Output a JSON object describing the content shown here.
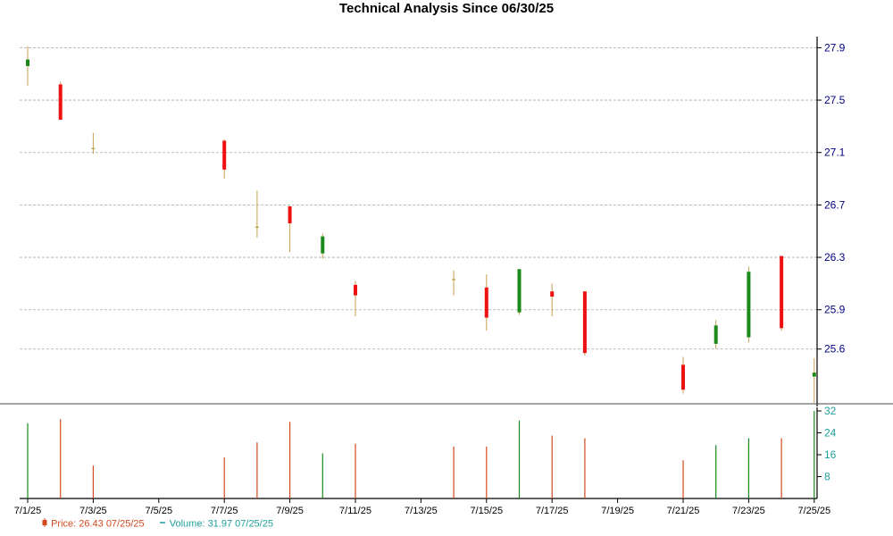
{
  "chart_data": {
    "type": "candlestick",
    "title": "Technical Analysis Since 06/30/25",
    "price_axis": {
      "ylim": [
        25.23,
        27.93
      ],
      "ticks": [
        "27.9",
        "27.5",
        "27.1",
        "26.7",
        "26.3",
        "25.9",
        "25.6"
      ]
    },
    "volume_axis": {
      "ylim": [
        0,
        32
      ],
      "ticks": [
        "32",
        "24",
        "16",
        "8"
      ]
    },
    "x_tick_labels": [
      "7/1/25",
      "7/3/25",
      "7/5/25",
      "7/7/25",
      "7/9/25",
      "7/11/25",
      "7/13/25",
      "7/15/25",
      "7/17/25",
      "7/19/25",
      "7/21/25",
      "7/23/25",
      "7/25/25"
    ],
    "candles": [
      {
        "date": "7/1/25",
        "open": 27.76,
        "high": 27.91,
        "low": 27.61,
        "close": 27.81,
        "volume": 27.5
      },
      {
        "date": "7/2/25",
        "open": 27.62,
        "high": 27.64,
        "low": 27.35,
        "close": 27.35,
        "volume": 29
      },
      {
        "date": "7/3/25",
        "open": 27.14,
        "high": 27.25,
        "low": 27.09,
        "close": 27.13,
        "volume": 12
      },
      {
        "date": "7/7/25",
        "open": 27.19,
        "high": 27.2,
        "low": 26.9,
        "close": 26.97,
        "volume": 15
      },
      {
        "date": "7/8/25",
        "open": 26.54,
        "high": 26.81,
        "low": 26.45,
        "close": 26.53,
        "volume": 20.5
      },
      {
        "date": "7/9/25",
        "open": 26.69,
        "high": 26.69,
        "low": 26.34,
        "close": 26.56,
        "volume": 28
      },
      {
        "date": "7/10/25",
        "open": 26.33,
        "high": 26.48,
        "low": 26.29,
        "close": 26.46,
        "volume": 16.5
      },
      {
        "date": "7/11/25",
        "open": 26.09,
        "high": 26.12,
        "low": 25.85,
        "close": 26.01,
        "volume": 20
      },
      {
        "date": "7/14/25",
        "open": 26.14,
        "high": 26.2,
        "low": 26.01,
        "close": 26.13,
        "volume": 19
      },
      {
        "date": "7/15/25",
        "open": 26.07,
        "high": 26.17,
        "low": 25.74,
        "close": 25.84,
        "volume": 19
      },
      {
        "date": "7/16/25",
        "open": 25.88,
        "high": 26.21,
        "low": 25.86,
        "close": 26.21,
        "volume": 28.5
      },
      {
        "date": "7/17/25",
        "open": 26.04,
        "high": 26.1,
        "low": 25.85,
        "close": 26.0,
        "volume": 23
      },
      {
        "date": "7/18/25",
        "open": 26.04,
        "high": 26.04,
        "low": 25.55,
        "close": 25.57,
        "volume": 22
      },
      {
        "date": "7/21/25",
        "open": 25.48,
        "high": 25.54,
        "low": 25.26,
        "close": 25.29,
        "volume": 14
      },
      {
        "date": "7/22/25",
        "open": 25.64,
        "high": 25.82,
        "low": 25.6,
        "close": 25.78,
        "volume": 19.5
      },
      {
        "date": "7/23/25",
        "open": 25.69,
        "high": 26.23,
        "low": 25.65,
        "close": 26.19,
        "volume": 22
      },
      {
        "date": "7/24/25",
        "open": 26.31,
        "high": 26.31,
        "low": 25.74,
        "close": 25.76,
        "volume": 22
      },
      {
        "date": "7/25/25",
        "open": 25.39,
        "high": 25.53,
        "low": 25.19,
        "close": 25.42,
        "volume": 31.97
      }
    ],
    "colors": {
      "up": "#1a8a1a",
      "down": "#ee1111",
      "doji": "#b5a040",
      "wick": "#c8a050",
      "grid": "#aaaaaa",
      "price_axis_text": "#000080",
      "volume_axis_text": "#1e9f9a",
      "up_volume": "#1a8a1a",
      "down_volume": "#d24a1e"
    }
  },
  "legend": {
    "price_label": "Price: 26.43  07/25/25",
    "volume_label": "Volume: 31.97  07/25/25"
  }
}
